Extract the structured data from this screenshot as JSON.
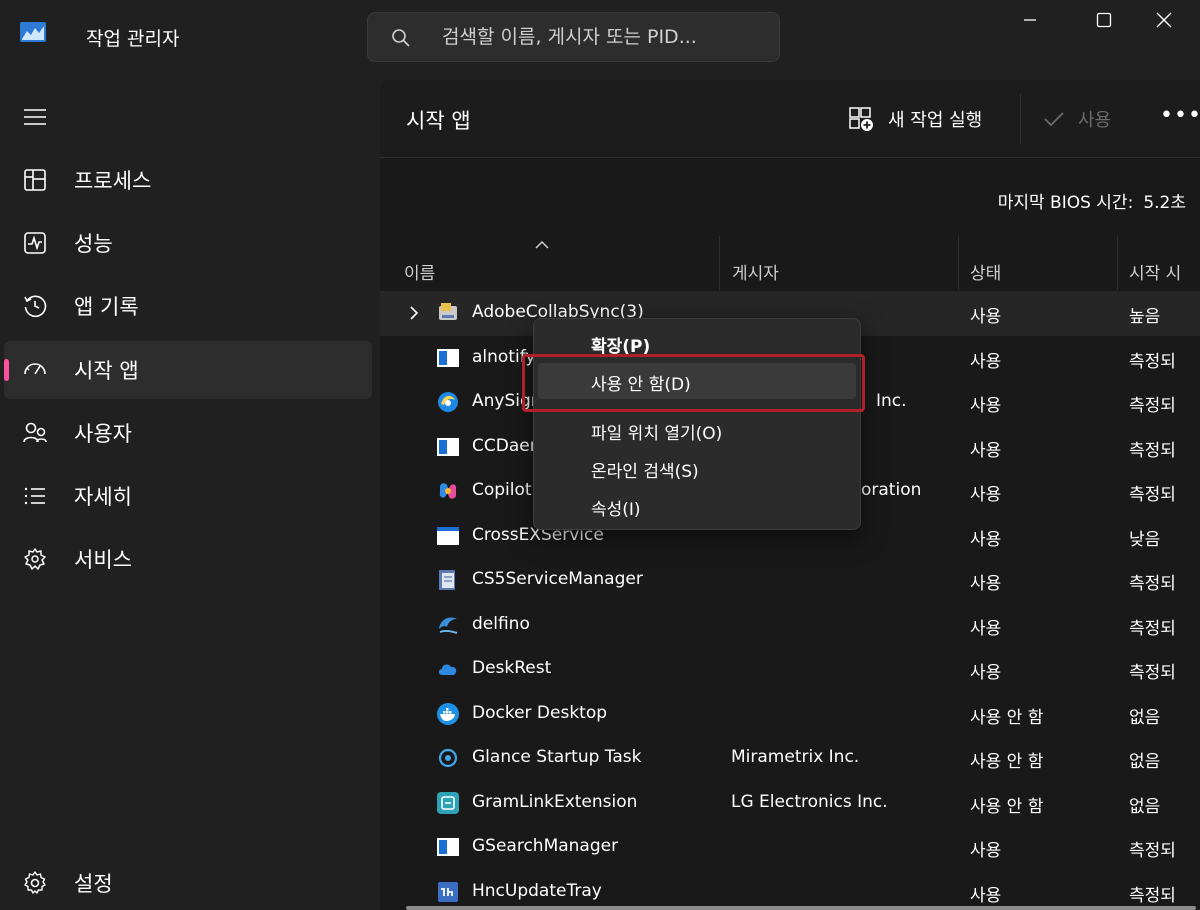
{
  "app": {
    "title": "작업 관리자",
    "icon": "task-manager-chart-icon"
  },
  "search": {
    "placeholder": "검색할 이름, 게시자 또는 PID..."
  },
  "window_controls": [
    "minimize-icon",
    "maximize-icon",
    "close-icon"
  ],
  "sidebar": {
    "menu_icon": "hamburger-icon",
    "items": [
      {
        "label": "프로세스",
        "icon": "processes-icon"
      },
      {
        "label": "성능",
        "icon": "performance-icon"
      },
      {
        "label": "앱 기록",
        "icon": "history-icon"
      },
      {
        "label": "시작 앱",
        "icon": "startup-icon",
        "active": true
      },
      {
        "label": "사용자",
        "icon": "users-icon"
      },
      {
        "label": "자세히",
        "icon": "details-icon"
      },
      {
        "label": "서비스",
        "icon": "services-icon"
      }
    ],
    "settings": {
      "label": "설정",
      "icon": "gear-icon"
    }
  },
  "toolbar": {
    "page_title": "시작 앱",
    "run_task": "새 작업 실행",
    "enable": "사용",
    "more": "•••"
  },
  "bios": {
    "label": "마지막 BIOS 시간:",
    "value": "5.2초"
  },
  "columns": {
    "name": "이름",
    "publisher": "게시자",
    "status": "상태",
    "impact": "시작 시"
  },
  "rows": [
    {
      "name": "AdobeCollabSync(3)",
      "publisher": "",
      "status": "사용",
      "impact": "높음",
      "expandable": true
    },
    {
      "name": "alnotify",
      "publisher": "",
      "status": "사용",
      "impact": "측정되"
    },
    {
      "name": "AnySign4PC",
      "publisher": "Inc.",
      "status": "사용",
      "impact": "측정되"
    },
    {
      "name": "CCDaemon",
      "publisher": "",
      "status": "사용",
      "impact": "측정되"
    },
    {
      "name": "Copilot",
      "publisher": "oration",
      "status": "사용",
      "impact": "측정되"
    },
    {
      "name": "CrossEXService",
      "publisher": "",
      "status": "사용",
      "impact": "낮음"
    },
    {
      "name": "CS5ServiceManager",
      "publisher": "",
      "status": "사용",
      "impact": "측정되"
    },
    {
      "name": "delfino",
      "publisher": "",
      "status": "사용",
      "impact": "측정되"
    },
    {
      "name": "DeskRest",
      "publisher": "",
      "status": "사용",
      "impact": "측정되"
    },
    {
      "name": "Docker Desktop",
      "publisher": "",
      "status": "사용 안 함",
      "impact": "없음"
    },
    {
      "name": "Glance Startup Task",
      "publisher": "Mirametrix Inc.",
      "status": "사용 안 함",
      "impact": "없음"
    },
    {
      "name": "GramLinkExtension",
      "publisher": "LG Electronics Inc.",
      "status": "사용 안 함",
      "impact": "없음"
    },
    {
      "name": "GSearchManager",
      "publisher": "",
      "status": "사용",
      "impact": "측정되"
    },
    {
      "name": "HncUpdateTray",
      "publisher": "",
      "status": "사용",
      "impact": "측정되"
    }
  ],
  "context_menu": {
    "items": [
      {
        "label": "확장(P)",
        "bold": true
      },
      {
        "label": "사용 안 함(D)",
        "highlighted": true
      },
      {
        "label": "파일 위치 열기(O)"
      },
      {
        "label": "온라인 검색(S)"
      },
      {
        "label": "속성(I)"
      }
    ],
    "highlight_color": "#b0202b"
  },
  "colors": {
    "accent": "#ff4fa1",
    "background": "#202020",
    "panel": "#191919"
  }
}
